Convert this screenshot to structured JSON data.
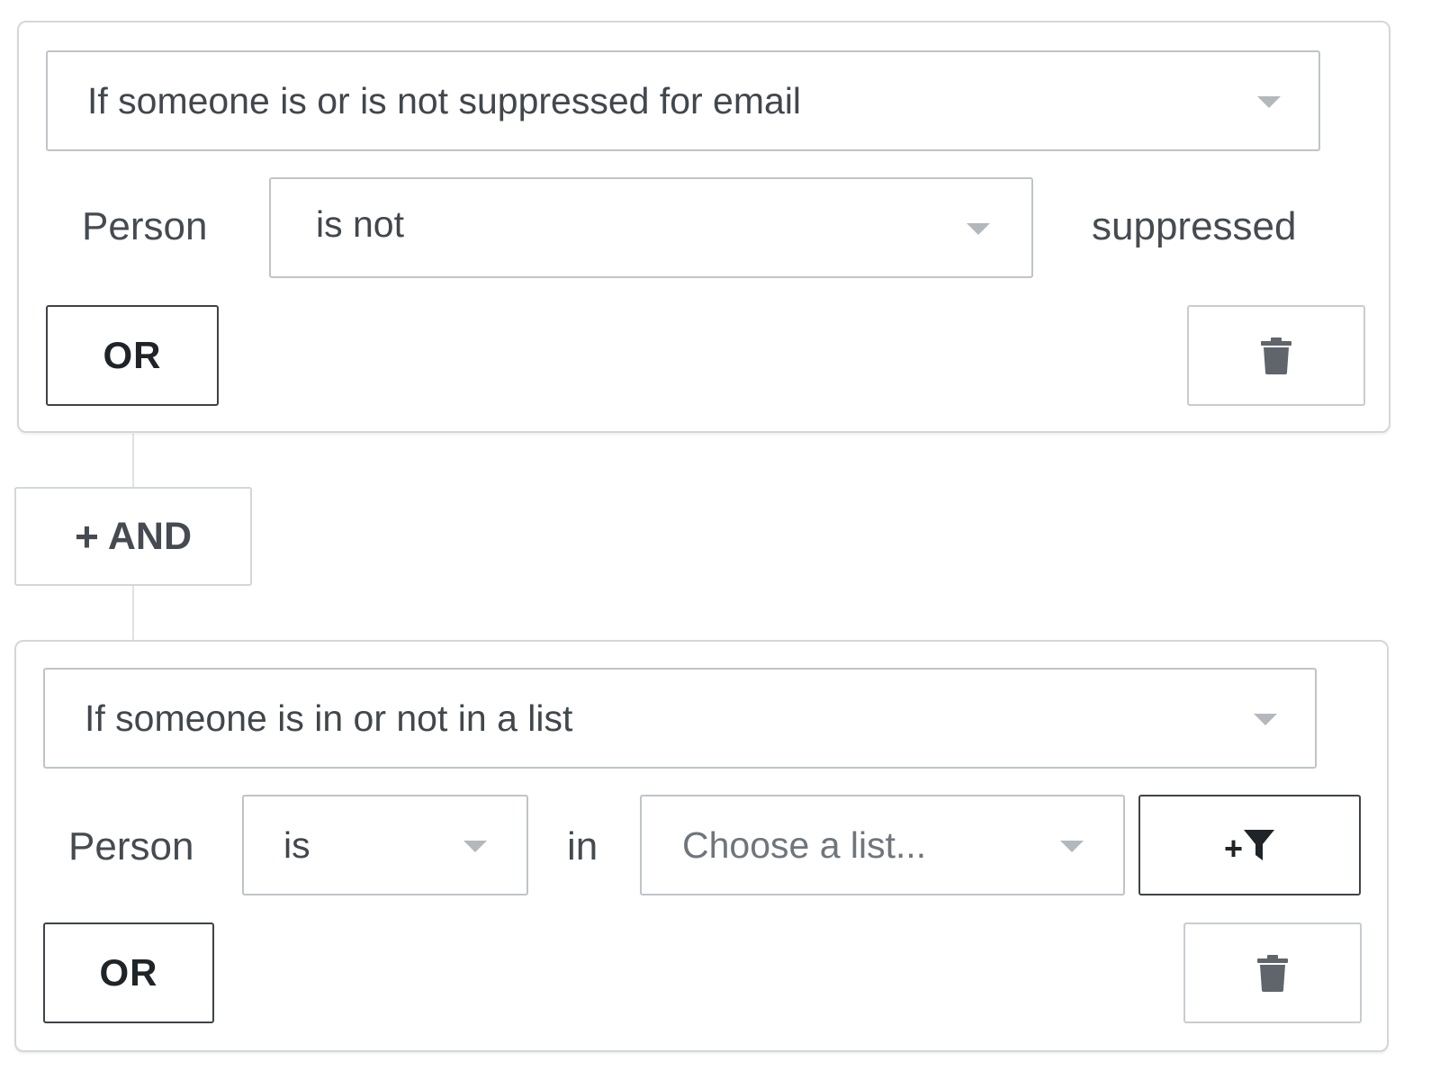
{
  "condition_1": {
    "type_select": "If someone is or is not suppressed for email",
    "subject_label": "Person",
    "operator_select": "is not",
    "value_label": "suppressed",
    "or_label": "OR"
  },
  "and_button": {
    "plus": "+",
    "label": "AND"
  },
  "condition_2": {
    "type_select": "If someone is in or not in a list",
    "subject_label": "Person",
    "operator_select": "is",
    "in_label": "in",
    "list_select_placeholder": "Choose a list...",
    "filter_button_plus": "+",
    "or_label": "OR"
  },
  "colors": {
    "border": "#d3d7db",
    "dark_border": "#3e4349",
    "text": "#454b51",
    "caret": "#b3b8bd"
  }
}
